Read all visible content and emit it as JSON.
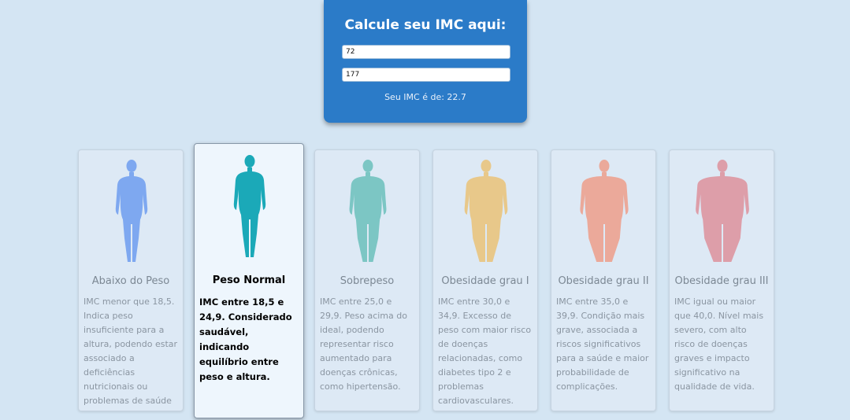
{
  "calculator": {
    "title": "Calcule seu IMC aqui:",
    "weight_value": "72",
    "height_value": "177",
    "result_text": "Seu IMC é de: 22.7"
  },
  "categories": [
    {
      "title": "Abaixo do Peso",
      "description": "IMC menor que 18,5. Indica peso insuficiente para a altura, podendo estar associado a deficiências nutricionais ou problemas de saúde",
      "color": "#7ea8f0",
      "icon": "thin-body-icon"
    },
    {
      "title": "Peso Normal",
      "description": "IMC entre 18,5 e 24,9. Considerado saudável, indicando equilíbrio entre peso e altura.",
      "color": "#1ba9b8",
      "icon": "normal-body-icon",
      "active": true
    },
    {
      "title": "Sobrepeso",
      "description": "IMC entre 25,0 e 29,9. Peso acima do ideal, podendo representar risco aumentado para doenças crônicas, como hipertensão.",
      "color": "#7cc6c4",
      "icon": "overweight-body-icon"
    },
    {
      "title": "Obesidade grau I",
      "description": "IMC entre 30,0 e 34,9. Excesso de peso com maior risco de doenças relacionadas, como diabetes tipo 2 e problemas cardiovasculares.",
      "color": "#e8c88a",
      "icon": "obese-1-body-icon"
    },
    {
      "title": "Obesidade grau II",
      "description": "IMC entre 35,0 e 39,9. Condição mais grave, associada a riscos significativos para a saúde e maior probabilidade de complicações.",
      "color": "#eba99a",
      "icon": "obese-2-body-icon"
    },
    {
      "title": "Obesidade grau III",
      "description": "IMC igual ou maior que 40,0. Nível mais severo, com alto risco de doenças graves e impacto significativo na qualidade de vida.",
      "color": "#dd9ea9",
      "icon": "obese-3-body-icon"
    }
  ]
}
